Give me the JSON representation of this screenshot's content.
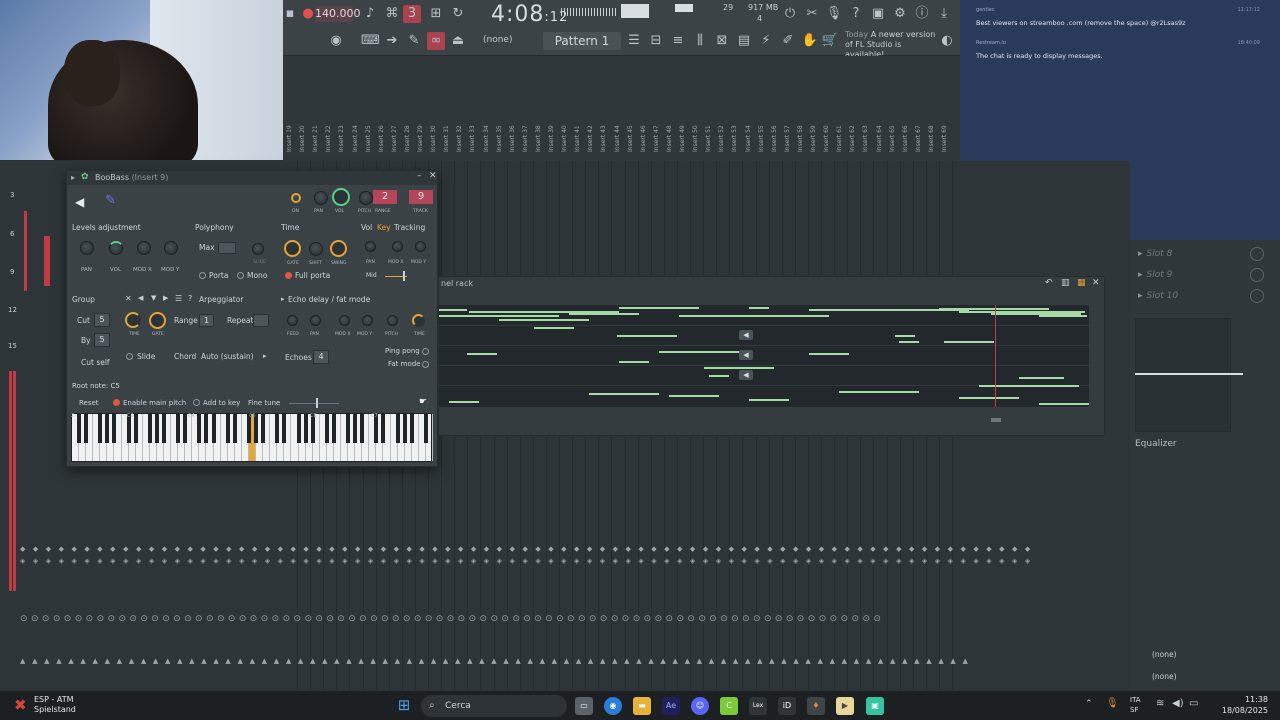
{
  "toolbar": {
    "tempo": "140.000",
    "time_main": "4:08",
    "time_sub": "12",
    "pattern_label": "Pattern 1",
    "pattern_none": "(none)",
    "memory": "917 MB",
    "cpu": "29",
    "voices": "4",
    "update_today": "Today",
    "update_message": "A newer version of FL Studio is available!"
  },
  "chat": {
    "msg1_name": "gentlec",
    "msg1_time": "11:17:12",
    "msg1_text": "Best viewers on streamboo .com (remove the space) @r2Lsas9z",
    "msg2_name": "Restream.io",
    "msg2_time": "18:40:09",
    "msg2_text": "The chat is ready to display messages."
  },
  "mixer": {
    "inserts": [
      "Insert 19",
      "Insert 20",
      "Insert 21",
      "Insert 22",
      "Insert 23",
      "Insert 24",
      "Insert 25",
      "Insert 26",
      "Insert 27",
      "Insert 28",
      "Insert 29",
      "Insert 30",
      "Insert 31",
      "Insert 32",
      "Insert 33",
      "Insert 34",
      "Insert 35",
      "Insert 36",
      "Insert 37",
      "Insert 38",
      "Insert 39",
      "Insert 40",
      "Insert 41",
      "Insert 42",
      "Insert 43",
      "Insert 44",
      "Insert 45",
      "Insert 46",
      "Insert 47",
      "Insert 48",
      "Insert 49",
      "Insert 50",
      "Insert 51",
      "Insert 52",
      "Insert 53",
      "Insert 54",
      "Insert 55",
      "Insert 56",
      "Insert 57",
      "Insert 58",
      "Insert 59",
      "Insert 60",
      "Insert 61",
      "Insert 62",
      "Insert 63",
      "Insert 64",
      "Insert 65",
      "Insert 66",
      "Insert 67",
      "Insert 68",
      "Insert 69"
    ],
    "left_numbers": [
      "3",
      "6",
      "9",
      "12",
      "15"
    ]
  },
  "plugin": {
    "title": "BooBass",
    "title_sub": "(Insert 9)",
    "top_knobs": [
      "ON",
      "PAN",
      "VOL",
      "PITCH",
      "RANGE",
      "TRACK"
    ],
    "range_value": "2",
    "track_value": "9",
    "levels_title": "Levels adjustment",
    "levels_knobs": [
      "PAN",
      "VOL",
      "MOD X",
      "MOD Y"
    ],
    "polyphony_title": "Polyphony",
    "max_label": "Max",
    "slide_label": "SLIDE",
    "porta_label": "Porta",
    "mono_label": "Mono",
    "time_title": "Time",
    "time_knobs": [
      "GATE",
      "SHIFT",
      "SWING"
    ],
    "full_porta": "Full porta",
    "vol_tab": "Vol",
    "key_tab": "Key",
    "tracking_tab": "Tracking",
    "tracking_knobs": [
      "PAN",
      "MOD X",
      "MOD Y"
    ],
    "mid_label": "Mid",
    "group_label": "Group",
    "arpeggiator_label": "Arpeggiator",
    "cut_label": "Cut",
    "cut_value": "5",
    "by_label": "By",
    "by_value": "5",
    "cut_self": "Cut self",
    "arp_knobs": [
      "TIME",
      "GATE"
    ],
    "range_label": "Range",
    "range_box": "1",
    "repeat_label": "Repeat",
    "slide_radio": "Slide",
    "chord_label": "Chord",
    "chord_value": "Auto (sustain)",
    "echo_title": "Echo delay / fat mode",
    "echo_knobs": [
      "FEED",
      "PAN",
      "MOD X",
      "MOD Y",
      "PITCH",
      "TIME"
    ],
    "echoes_label": "Echoes",
    "echoes_value": "4",
    "ping_pong": "Ping pong",
    "fat_mode": "Fat mode",
    "root_note": "Root note: C5",
    "reset": "Reset",
    "enable_main_pitch": "Enable main pitch",
    "add_to_key": "Add to key",
    "fine_tune": "Fine tune",
    "key_labels": [
      "2",
      "C3",
      "C4",
      "C5",
      "C6",
      "C7"
    ]
  },
  "rack": {
    "title": "nel rack"
  },
  "right_panel": {
    "slots": [
      "Slot 8",
      "Slot 9",
      "Slot 10"
    ],
    "equalizer": "Equalizer",
    "none1": "(none)",
    "none2": "(none)"
  },
  "taskbar": {
    "weather_title": "ESP - ATM",
    "weather_sub": "Spielstand",
    "search": "Cerca",
    "lang1": "ITA",
    "lang2": "SF",
    "clock_time": "11:38",
    "clock_date": "18/08/2025",
    "apps": [
      "Ae",
      "Lex",
      "iD"
    ]
  },
  "colors": {
    "accent_red": "#c23a44",
    "knob_orange": "#e2a437",
    "knob_green": "#58d08a",
    "note_green": "#a5d9a5",
    "chat_bg": "#2a3a5a"
  }
}
